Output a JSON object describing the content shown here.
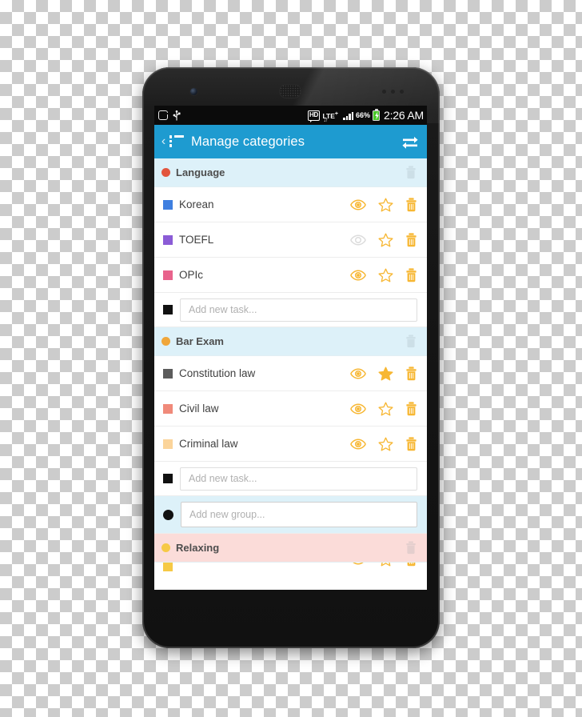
{
  "statusbar": {
    "app_icon": "app-badge-icon",
    "usb_icon": "usb-icon",
    "hd_label": "HD",
    "network_label": "LTE",
    "network_sup": "+",
    "network_arrows": "↓↑",
    "signal_icon": "signal-bars-icon",
    "battery_percent": "66%",
    "battery_icon": "battery-charging-icon",
    "clock": "2:26 AM"
  },
  "appbar": {
    "back_icon": "back-chevron-icon",
    "menu_icon": "list-menu-icon",
    "title": "Manage categories",
    "sync_icon": "sync-refresh-icon",
    "bg_color": "#1e9bd0"
  },
  "colors": {
    "header_blue": "#ddf1f9",
    "header_pink": "#fbdcd9",
    "accent_orange": "#f5a623",
    "icon_orange": "#f7b733",
    "icon_disabled": "#dcdcdc"
  },
  "actions": {
    "visible_label": "visibility-eye-icon",
    "hidden_label": "visibility-off-eye-icon",
    "star_label": "favorite-star-icon",
    "delete_label": "delete-trash-icon"
  },
  "list": [
    {
      "type": "group",
      "name": "Language",
      "dot_color": "#e2553d",
      "header_style": "blue",
      "tasks": [
        {
          "name": "Korean",
          "swatch": "#3f7fe0",
          "visible": true,
          "starred": false
        },
        {
          "name": "TOEFL",
          "swatch": "#8b5cd6",
          "visible": false,
          "starred": false
        },
        {
          "name": "OPIc",
          "swatch": "#e8638c",
          "visible": true,
          "starred": false
        }
      ],
      "add_task_placeholder": "Add new task..."
    },
    {
      "type": "group",
      "name": "Bar Exam",
      "dot_color": "#f0a63a",
      "header_style": "blue",
      "tasks": [
        {
          "name": "Constitution law",
          "swatch": "#5c5c5c",
          "visible": true,
          "starred": true
        },
        {
          "name": "Civil law",
          "swatch": "#f08a7a",
          "visible": true,
          "starred": false
        },
        {
          "name": "Criminal law",
          "swatch": "#fbd49a",
          "visible": true,
          "starred": false
        }
      ],
      "add_task_placeholder": "Add new task..."
    }
  ],
  "add_group": {
    "placeholder": "Add new group...",
    "dot_color": "#111111"
  },
  "trailing_group": {
    "name": "Relaxing",
    "dot_color": "#f6c945",
    "header_style": "pink"
  },
  "cut_row": {
    "swatch": "#f6c945"
  }
}
